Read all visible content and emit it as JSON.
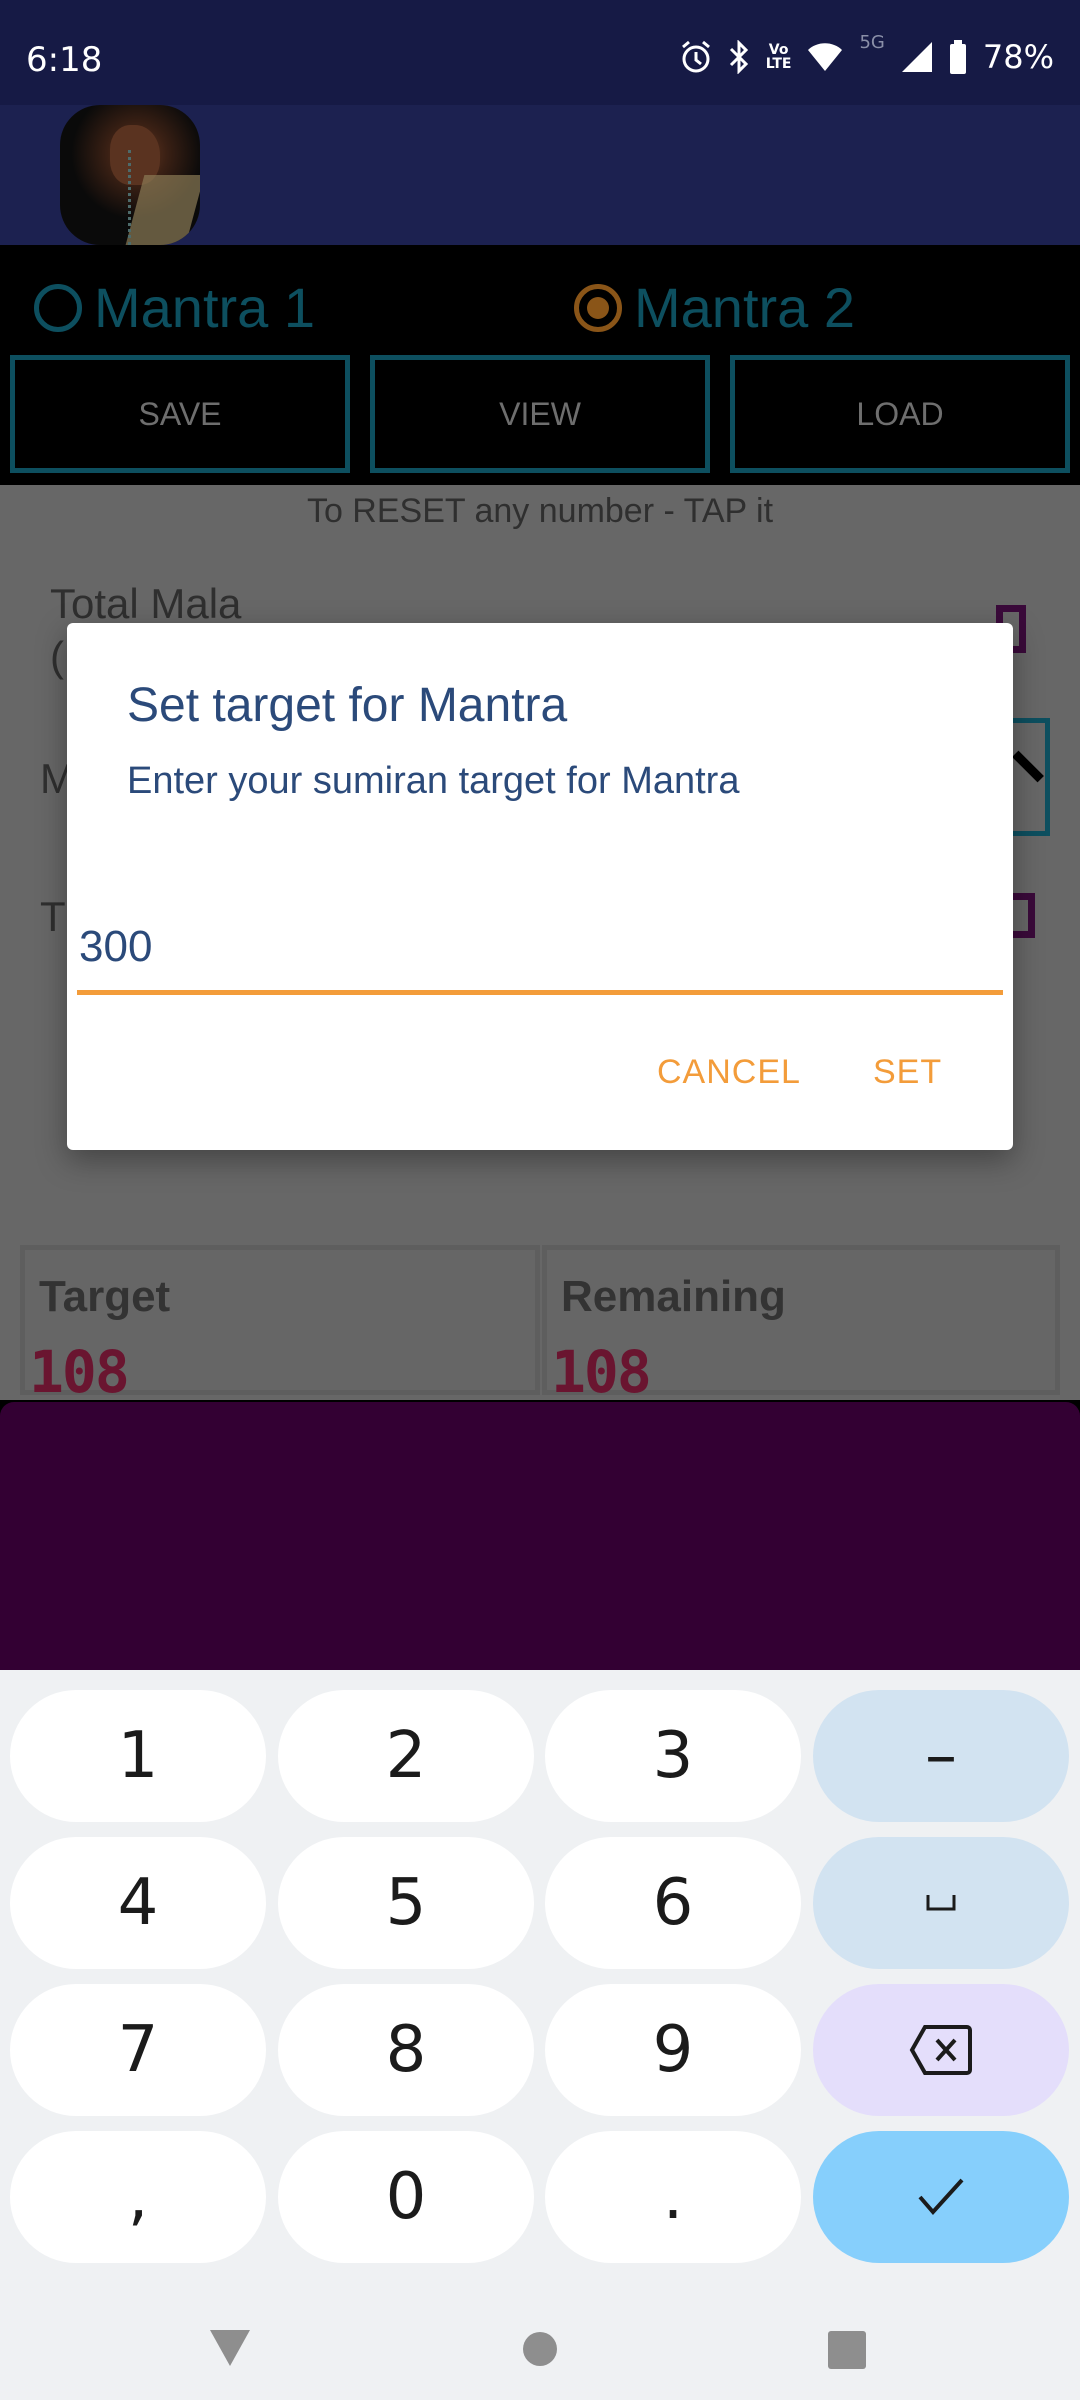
{
  "status_bar": {
    "time": "6:18",
    "icons": [
      "alarm-icon",
      "bluetooth-icon",
      "volte-icon",
      "wifi-icon",
      "5g-icon",
      "signal-icon",
      "battery-icon"
    ],
    "volte_label_top": "Vo",
    "volte_label_bottom": "LTE",
    "network_label": "5G",
    "battery": "78%"
  },
  "app": {
    "logo": "mala-beads-image"
  },
  "mantra_selector": {
    "options": [
      {
        "label": "Mantra 1",
        "checked": false
      },
      {
        "label": "Mantra 2",
        "checked": true
      }
    ]
  },
  "toolbar": {
    "save_label": "SAVE",
    "view_label": "VIEW",
    "load_label": "LOAD"
  },
  "content": {
    "reset_hint": "To RESET any number - TAP it",
    "total_mala_label": "Total Mala",
    "total_mala_paren": "(",
    "row2_label_fragment": "M",
    "row3_label_fragment": "T",
    "target_label": "Target",
    "target_value": "108",
    "remaining_label": "Remaining",
    "remaining_value": "108"
  },
  "dialog": {
    "title": "Set target for Mantra",
    "message": "Enter your sumiran target for Mantra",
    "input_value": "300",
    "cancel_label": "CANCEL",
    "set_label": "SET"
  },
  "keyboard": {
    "rows": [
      [
        "1",
        "2",
        "3",
        "–"
      ],
      [
        "4",
        "5",
        "6",
        "␣"
      ],
      [
        "7",
        "8",
        "9",
        "backspace"
      ],
      [
        ",",
        "0",
        ".",
        "✓"
      ]
    ],
    "colors": {
      "key": "#ffffff",
      "function_key": "#d2e3f1",
      "delete_key": "#e4defb",
      "enter_key": "#86cffc"
    }
  },
  "navbar": {
    "buttons": [
      "back",
      "home",
      "recents"
    ]
  },
  "colors": {
    "status_bar": "#161a45",
    "app_header": "#1c2150",
    "accent_teal": "#0d4f5f",
    "accent_orange": "#f39c3a",
    "dialog_text": "#2b4a7a",
    "purple_panel": "#330033"
  }
}
